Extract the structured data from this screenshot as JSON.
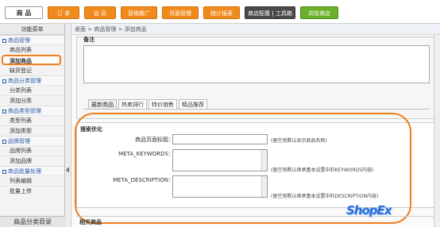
{
  "topnav": {
    "main": "商 品",
    "tabs": [
      "订 单",
      "会 员",
      "营销推广",
      "页面管理",
      "统计报表"
    ],
    "config": "商店配置",
    "sep": "|",
    "toolbox": "工具箱",
    "browse": "浏览商店"
  },
  "sidebar": {
    "title": "功能菜单",
    "groups": [
      {
        "label": "商品管理",
        "items": [
          "商品列表",
          "添加商品",
          "缺货登记"
        ]
      },
      {
        "label": "商品分类管理",
        "items": [
          "分类列表",
          "添加分类"
        ]
      },
      {
        "label": "商品类型管理",
        "items": [
          "类型列表",
          "添加类型"
        ]
      },
      {
        "label": "品牌管理",
        "items": [
          "品牌列表",
          "添加品牌"
        ]
      },
      {
        "label": "商品批量处理",
        "items": [
          "列表编辑",
          "批量上传"
        ]
      }
    ],
    "bottom": "商品分类目录"
  },
  "crumb": "桌面 > 商品管理 > 添加商品",
  "remark_label": "备注",
  "tabs": [
    "最新商品",
    "热卖排行",
    "特价销售",
    "精品推荐"
  ],
  "seo": {
    "title": "搜索优化",
    "fields": [
      {
        "label": "商品页面标题：",
        "hint": "(留空则默认显示商品名称)"
      },
      {
        "label": "META_KEYWORDS：",
        "hint": "(留空则默认继承基本设置中的KEYWORDS内容)"
      },
      {
        "label": "META_DESCRIPTION：",
        "hint": "(留空则默认继承基本设置中的DESCRIPTION内容)"
      }
    ]
  },
  "related": "相关商品",
  "logo": "ShopEx",
  "colors": {
    "accent": "#f07d1c",
    "nav_orange": "#f08a1c",
    "green": "#6ab02a",
    "link": "#2a5aa8"
  }
}
